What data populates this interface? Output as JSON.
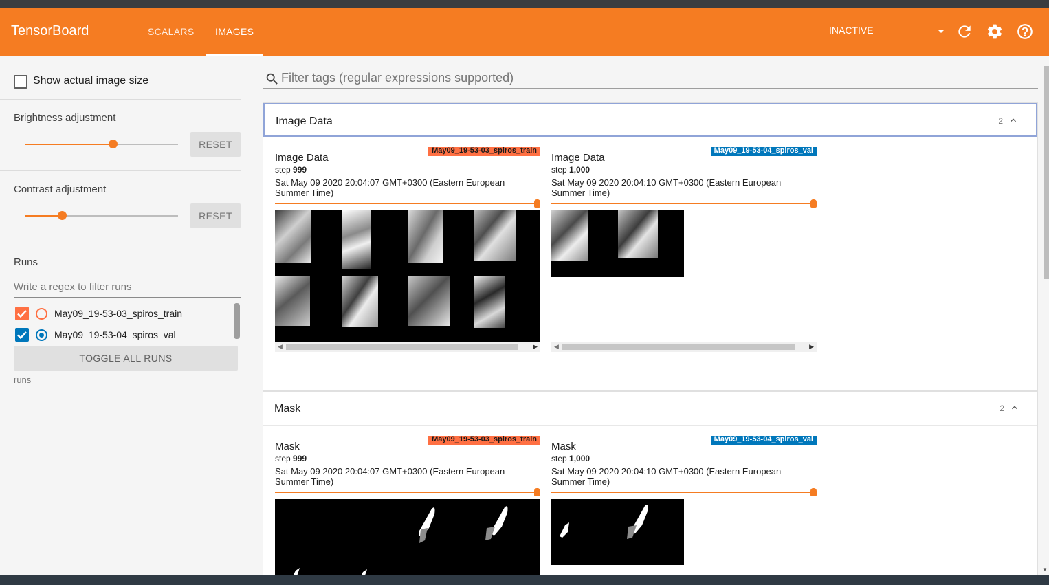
{
  "header": {
    "brand": "TensorBoard",
    "tabs": [
      {
        "label": "SCALARS"
      },
      {
        "label": "IMAGES"
      }
    ],
    "active_tab": "IMAGES",
    "run_select_value": "INACTIVE",
    "icons": [
      "refresh-icon",
      "settings-icon",
      "help-icon"
    ],
    "accent_color": "#f57c22"
  },
  "sidebar": {
    "show_actual_size_label": "Show actual image size",
    "show_actual_size_checked": false,
    "brightness_label": "Brightness adjustment",
    "brightness_level": 0.57,
    "contrast_label": "Contrast adjustment",
    "contrast_level": 0.24,
    "reset_label": "RESET",
    "runs_heading": "Runs",
    "runs_filter_placeholder": "Write a regex to filter runs",
    "runs": [
      {
        "name": "May09_19-53-03_spiros_train",
        "color": "#ff7043",
        "checked": true,
        "selected": false
      },
      {
        "name": "May09_19-53-04_spiros_val",
        "color": "#0077bb",
        "checked": true,
        "selected": true
      }
    ],
    "toggle_all_label": "TOGGLE ALL RUNS",
    "runs_footer": "runs"
  },
  "main": {
    "search_placeholder": "Filter tags (regular expressions supported)",
    "sections": [
      {
        "title": "Image Data",
        "count": "2",
        "cards": [
          {
            "title": "Image Data",
            "run": "May09_19-53-03_spiros_train",
            "step_label": "step",
            "step": "999",
            "date": "Sat May 09 2020 20:04:07 GMT+0300 (Eastern European Summer Time)"
          },
          {
            "title": "Image Data",
            "run": "May09_19-53-04_spiros_val",
            "step_label": "step",
            "step": "1,000",
            "date": "Sat May 09 2020 20:04:10 GMT+0300 (Eastern European Summer Time)"
          }
        ]
      },
      {
        "title": "Mask",
        "count": "2",
        "cards": [
          {
            "title": "Mask",
            "run": "May09_19-53-03_spiros_train",
            "step_label": "step",
            "step": "999",
            "date": "Sat May 09 2020 20:04:07 GMT+0300 (Eastern European Summer Time)"
          },
          {
            "title": "Mask",
            "run": "May09_19-53-04_spiros_val",
            "step_label": "step",
            "step": "1,000",
            "date": "Sat May 09 2020 20:04:10 GMT+0300 (Eastern European Summer Time)"
          }
        ]
      }
    ]
  }
}
